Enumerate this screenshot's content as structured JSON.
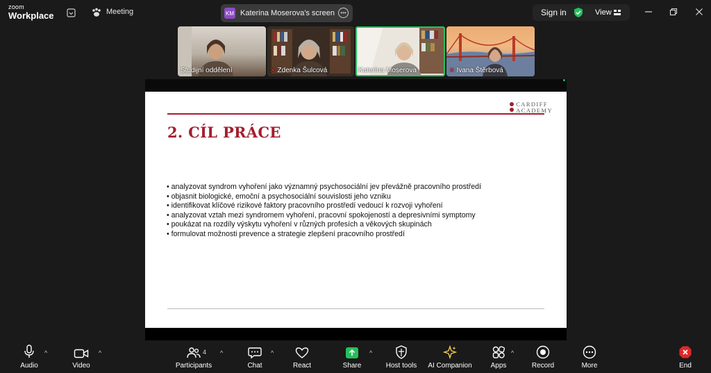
{
  "window": {
    "brand_top": "zoom",
    "brand_main": "Workplace",
    "meeting_label": "Meeting",
    "avatar_initials": "KM",
    "share_indicator": "Katerina Moserova's screen",
    "sign_in": "Sign in",
    "view": "View"
  },
  "participants": [
    {
      "name": "Studijní oddělení",
      "muted": false
    },
    {
      "name": "Zdenka Šulcová",
      "muted": true
    },
    {
      "name": "Katerina Moserova",
      "muted": false,
      "active_speaker": true
    },
    {
      "name": "Ivana Štěrbová",
      "muted": true
    }
  ],
  "slide": {
    "logo_line1": "CARDIFF",
    "logo_line2": "ACADEMY",
    "title": "2. CÍL PRÁCE",
    "bullets": [
      "• analyzovat syndrom vyhoření jako významný psychosociální jev převážně pracovního prostředí",
      "• objasnit biologické, emoční a psychosociální souvislosti jeho vzniku",
      "• identifikovat klíčové rizikové faktory pracovního prostředí vedoucí k rozvoji vyhoření",
      "• analyzovat vztah mezi syndromem vyhoření, pracovní spokojeností a depresivními symptomy",
      "• poukázat na rozdíly výskytu vyhoření v různých profesích a věkových skupinách",
      "• formulovat možnosti prevence a strategie zlepšení pracovního prostředí"
    ]
  },
  "toolbar": {
    "audio": "Audio",
    "video": "Video",
    "participants": "Participants",
    "participant_count": "4",
    "chat": "Chat",
    "react": "React",
    "share": "Share",
    "host_tools": "Host tools",
    "ai_companion": "AI Companion",
    "apps": "Apps",
    "record": "Record",
    "more": "More",
    "end": "End"
  },
  "colors": {
    "accent_green": "#24c05b",
    "slide_red": "#a31f2e",
    "end_red": "#e02828",
    "companion_gold": "#f2c94c"
  }
}
